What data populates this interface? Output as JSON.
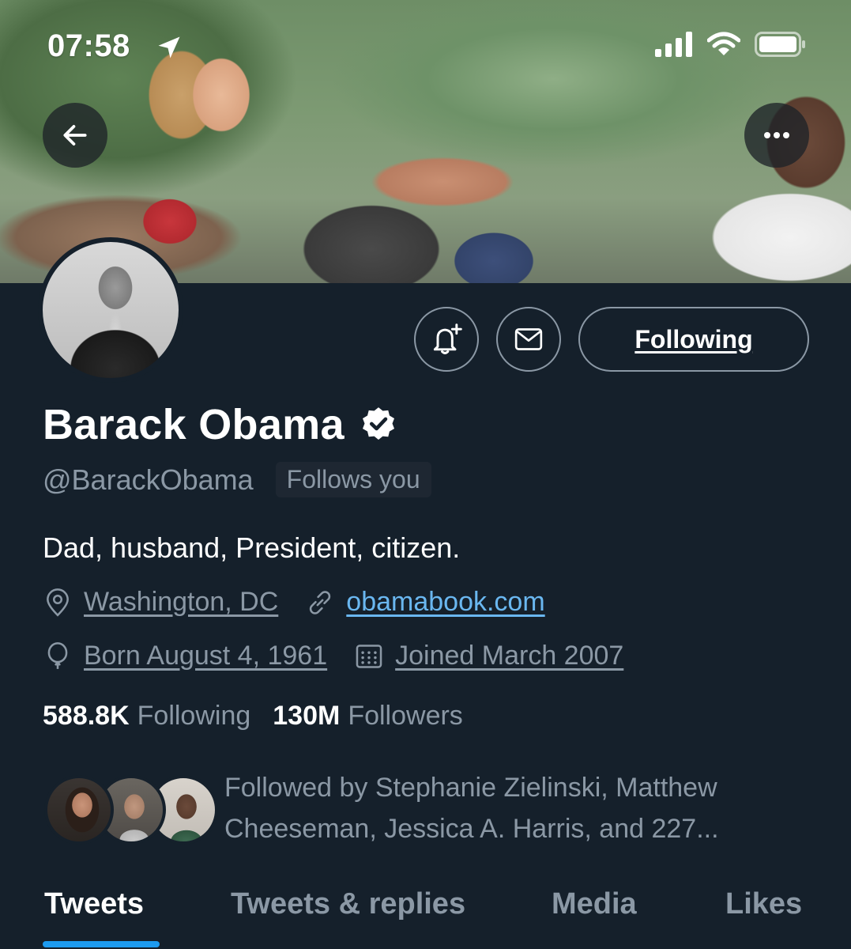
{
  "status_bar": {
    "time": "07:58"
  },
  "profile": {
    "display_name": "Barack Obama",
    "handle": "@BarackObama",
    "follows_you_badge": "Follows you",
    "bio": "Dad, husband, President, citizen.",
    "location": "Washington, DC",
    "website": "obamabook.com",
    "birthday": "Born August 4, 1961",
    "joined": "Joined March 2007",
    "following_count": "588.8K",
    "following_label": "Following",
    "followers_count": "130M",
    "followers_label": "Followers",
    "followed_by": "Followed by Stephanie Zielinski, Matthew Cheeseman, Jessica A. Harris, and 227..."
  },
  "actions": {
    "following_label": "Following"
  },
  "tabs": [
    {
      "label": "Tweets",
      "active": true
    },
    {
      "label": "Tweets & replies",
      "active": false
    },
    {
      "label": "Media",
      "active": false
    },
    {
      "label": "Likes",
      "active": false
    }
  ],
  "colors": {
    "background": "#15202b",
    "accent": "#1d9bf0",
    "link": "#6ab7f0",
    "secondary_text": "#8b98a5"
  },
  "icons": [
    "location-arrow-icon",
    "signal-icon",
    "wifi-icon",
    "battery-icon",
    "back-arrow-icon",
    "more-icon",
    "bell-plus-icon",
    "mail-icon",
    "verified-icon",
    "location-pin-icon",
    "link-icon",
    "balloon-icon",
    "calendar-icon"
  ]
}
